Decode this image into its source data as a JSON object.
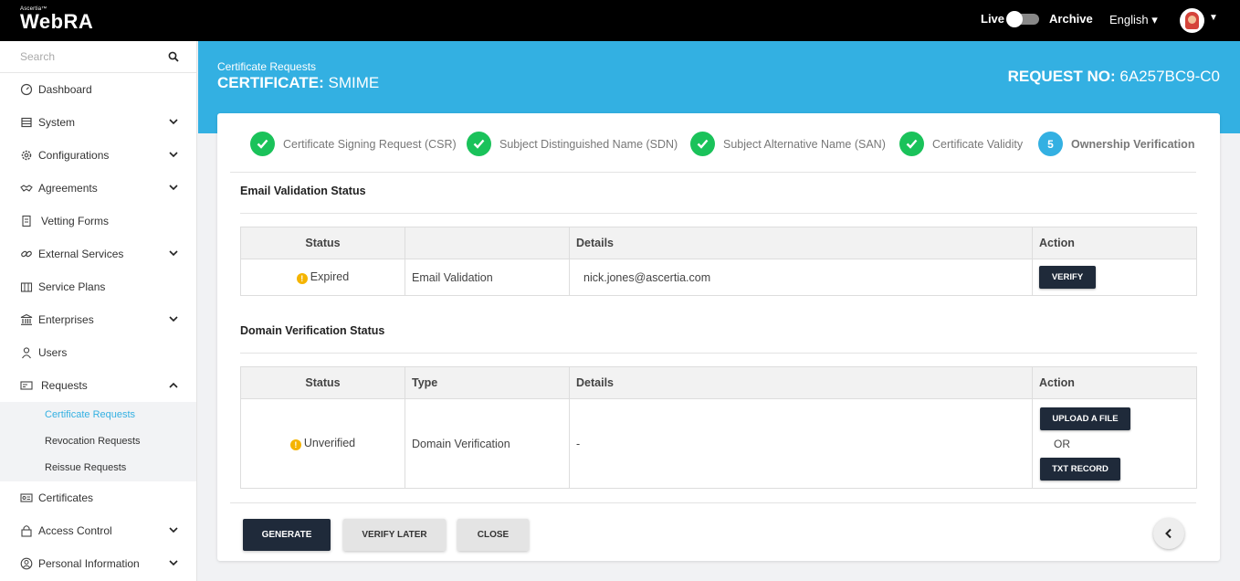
{
  "app": {
    "brand_small": "Ascertia™",
    "brand": "WebRA"
  },
  "topbar": {
    "live_label": "Live",
    "archive_label": "Archive",
    "language": "English ▾"
  },
  "search": {
    "placeholder": "Search"
  },
  "sidebar": {
    "items": [
      {
        "label": "Dashboard",
        "icon": "dashboard-icon"
      },
      {
        "label": "System",
        "icon": "system-icon"
      },
      {
        "label": "Configurations",
        "icon": "gear-icon"
      },
      {
        "label": "Agreements",
        "icon": "handshake-icon"
      },
      {
        "label": "Vetting Forms",
        "icon": "form-icon"
      },
      {
        "label": "External Services",
        "icon": "link-icon"
      },
      {
        "label": "Service Plans",
        "icon": "plans-icon"
      },
      {
        "label": "Enterprises",
        "icon": "bank-icon"
      },
      {
        "label": "Users",
        "icon": "user-icon"
      },
      {
        "label": "Requests",
        "icon": "requests-icon"
      },
      {
        "label": "Certificates",
        "icon": "certificate-icon"
      },
      {
        "label": "Access Control",
        "icon": "lock-icon"
      },
      {
        "label": "Personal Information",
        "icon": "person-icon"
      }
    ],
    "requests_sub": [
      "Certificate Requests",
      "Revocation Requests",
      "Reissue Requests"
    ]
  },
  "banner": {
    "crumb": "Certificate Requests",
    "cert_prefix": "CERTIFICATE:",
    "cert_value": "SMIME",
    "req_prefix": "REQUEST NO:",
    "req_value": "6A257BC9-C0"
  },
  "steps": [
    {
      "label": "Certificate Signing Request (CSR)",
      "state": "done"
    },
    {
      "label": "Subject Distinguished Name (SDN)",
      "state": "done"
    },
    {
      "label": "Subject Alternative Name (SAN)",
      "state": "done"
    },
    {
      "label": "Certificate Validity",
      "state": "done"
    },
    {
      "number": "5",
      "label": "Ownership Verification",
      "state": "current"
    }
  ],
  "email_section": {
    "title": "Email Validation Status",
    "headers": [
      "Status",
      "",
      "Details",
      "Action"
    ],
    "row": {
      "status": "Expired",
      "type": "Email Validation",
      "details": "nick.jones@ascertia.com",
      "action": "VERIFY"
    }
  },
  "domain_section": {
    "title": "Domain Verification Status",
    "headers": [
      "Status",
      "Type",
      "Details",
      "Action"
    ],
    "row": {
      "status": "Unverified",
      "type": "Domain Verification",
      "details": "-",
      "action_upload": "UPLOAD A FILE",
      "action_or": "OR",
      "action_txt": "TXT RECORD"
    }
  },
  "footer": {
    "generate": "GENERATE",
    "verify_later": "VERIFY LATER",
    "close": "CLOSE"
  },
  "colors": {
    "accent": "#33b0e2",
    "success": "#1ac25a",
    "dark_button": "#1f2a3a",
    "warning": "#f5b400"
  }
}
